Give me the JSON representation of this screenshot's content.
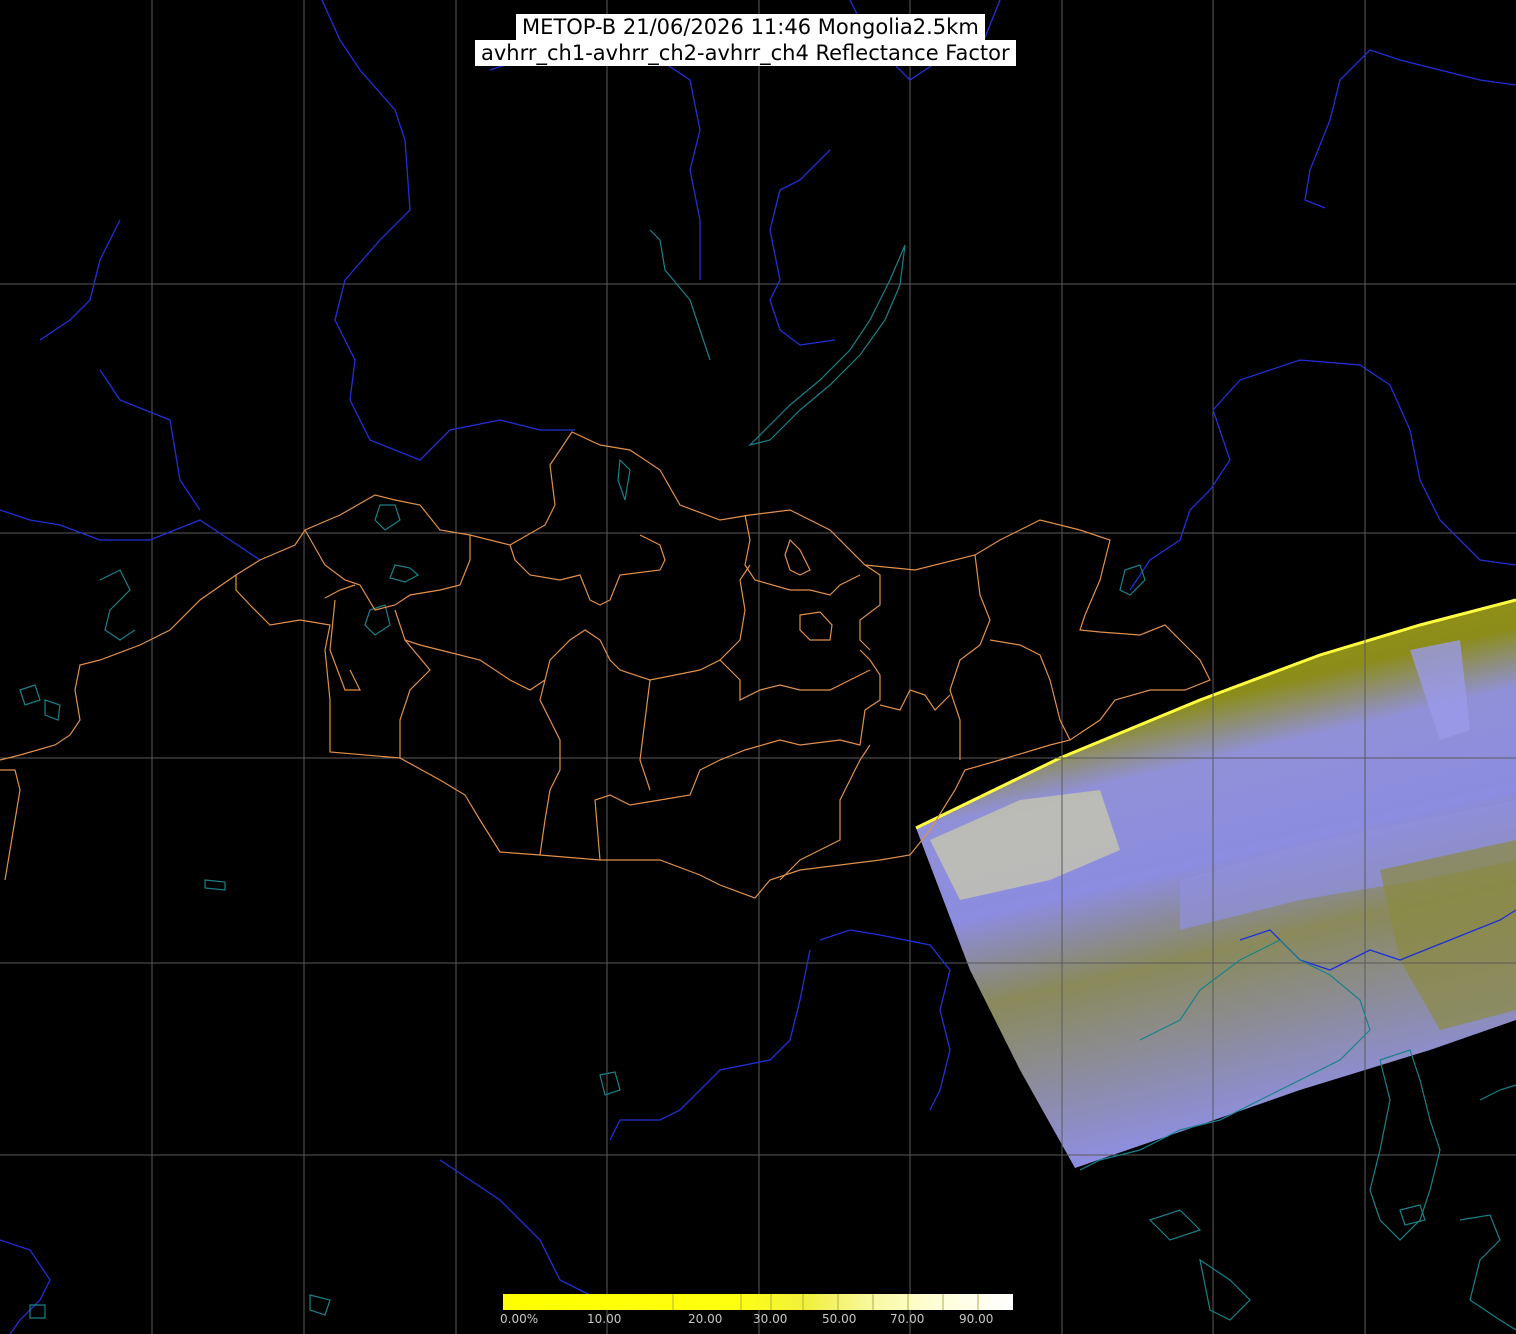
{
  "title": {
    "line1": "METOP-B 21/06/2026 11:46 Mongolia2.5km",
    "line2": "avhrr_ch1-avhrr_ch2-avhrr_ch4 Reflectance Factor"
  },
  "colorbar": {
    "labels": [
      "0.00%",
      "10.00",
      "20.00",
      "30.00",
      "50.00",
      "70.00",
      "90.00"
    ],
    "colors": [
      "#ffff00",
      "#ffff33",
      "#f0f040",
      "#f8f8a0",
      "#ffffd0",
      "#ffffff"
    ]
  },
  "colors": {
    "background": "#000000",
    "grid": "#5a5a5a",
    "borders": "#e0904a",
    "rivers": "#2030d8",
    "lakes": "#1a7a80",
    "swath_yellow": "#8f8f14",
    "swath_blue": "#8a8ae0"
  }
}
